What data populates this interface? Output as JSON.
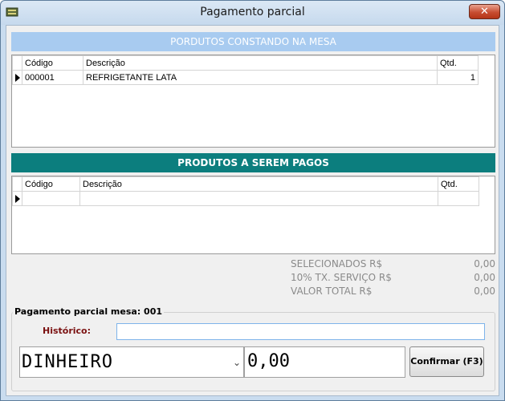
{
  "window": {
    "title": "Pagamento parcial",
    "close_symbol": "✕",
    "app_icon": "table-app-icon"
  },
  "section_top": {
    "title": "PORDUTOS CONSTANDO NA MESA",
    "headers": [
      "Código",
      "Descrição",
      "Qtd."
    ],
    "rows": [
      {
        "codigo": "000001",
        "descricao": "REFRIGETANTE LATA",
        "qtd": "1"
      }
    ]
  },
  "section_mid": {
    "title": "PRODUTOS A SEREM PAGOS",
    "headers": [
      "Código",
      "Descrição",
      "Qtd."
    ]
  },
  "summary": [
    {
      "label": "SELECIONADOS R$",
      "value": "0,00"
    },
    {
      "label": "10% TX. SERVIÇO R$",
      "value": "0,00"
    },
    {
      "label": "VALOR TOTAL R$",
      "value": "0,00"
    }
  ],
  "payment": {
    "group_title": "Pagamento parcial mesa: 001",
    "historico_label": "Histórico:",
    "historico_value": "",
    "method": "DINHEIRO",
    "amount": "0,00",
    "confirm_label": "Confirmar (F3)"
  },
  "colors": {
    "band_top": "#a8cbf0",
    "band_mid": "#0c7e7e",
    "historico_label": "#7a1010"
  }
}
